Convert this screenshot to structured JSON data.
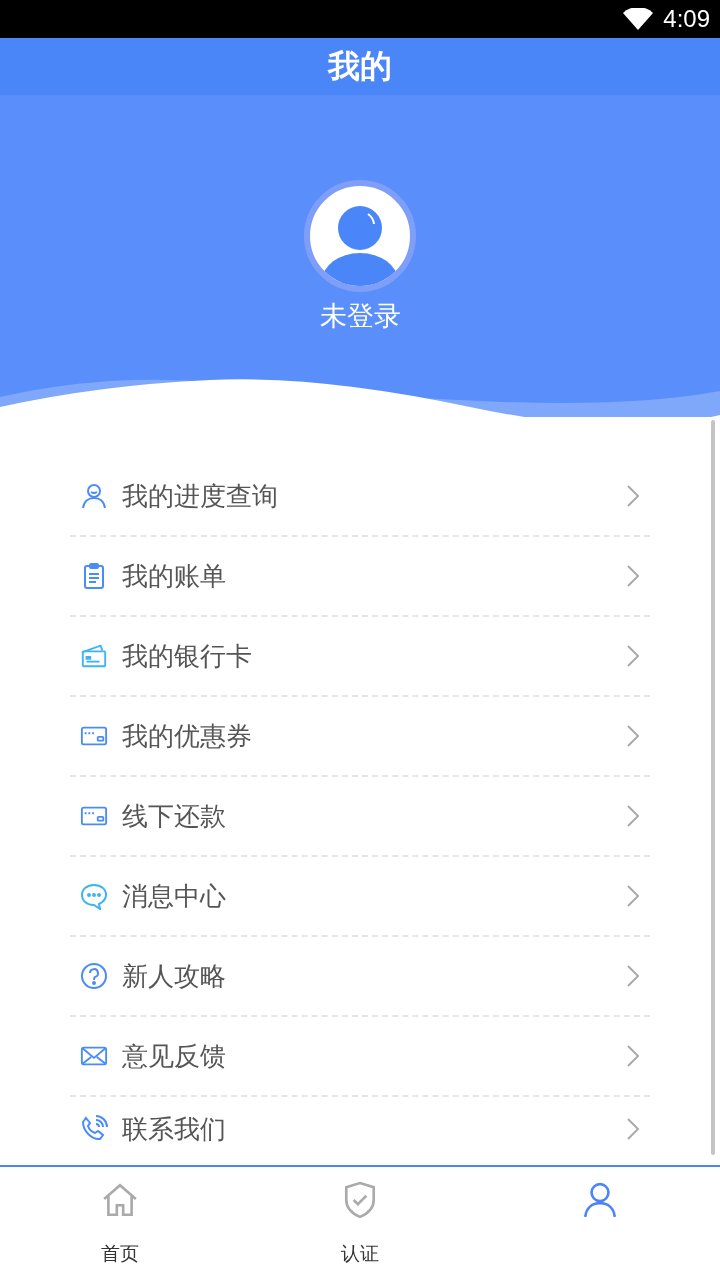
{
  "status_bar": {
    "time": "4:09"
  },
  "header": {
    "title": "我的"
  },
  "profile": {
    "name": "未登录"
  },
  "menu": [
    {
      "kind": "person",
      "label": "我的进度查询"
    },
    {
      "kind": "clipboard",
      "label": "我的账单"
    },
    {
      "kind": "cards",
      "label": "我的银行卡"
    },
    {
      "kind": "card",
      "label": "我的优惠券"
    },
    {
      "kind": "card",
      "label": "线下还款"
    },
    {
      "kind": "chat",
      "label": "消息中心"
    },
    {
      "kind": "question",
      "label": "新人攻略"
    },
    {
      "kind": "mail",
      "label": "意见反馈"
    },
    {
      "kind": "phone",
      "label": "联系我们"
    }
  ],
  "tab_bar": [
    {
      "kind": "home",
      "label": "首页",
      "selected": false
    },
    {
      "kind": "shield",
      "label": "认证",
      "selected": false
    },
    {
      "kind": "person",
      "selected": true
    }
  ]
}
